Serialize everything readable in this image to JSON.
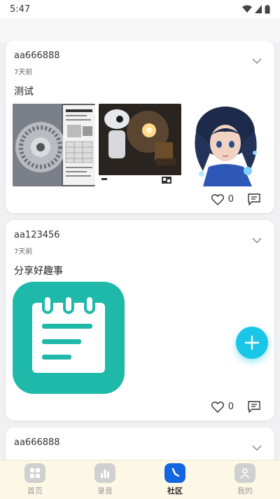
{
  "status_bar": {
    "time": "5:47"
  },
  "posts": [
    {
      "username": "aa666888",
      "time_ago": "7天前",
      "content": "测试",
      "likes": "0",
      "image_subjects": [
        "machine-gear-collage",
        "robot-scene",
        "anime-portrait"
      ]
    },
    {
      "username": "aa123456",
      "time_ago": "7天前",
      "content": "分享好趣事",
      "likes": "0",
      "image_subjects": [
        "notepad-app-icon"
      ]
    },
    {
      "username": "aa666888"
    }
  ],
  "tabbar": {
    "items": [
      {
        "label": "首页",
        "icon": "home-grid-icon"
      },
      {
        "label": "录音",
        "icon": "bar-chart-icon"
      },
      {
        "label": "社区",
        "icon": "compass-icon",
        "active": true
      },
      {
        "label": "我的",
        "icon": "person-icon"
      }
    ]
  },
  "colors": {
    "accent": "#1466e0",
    "fab": "#19c6e8",
    "note_icon": "#1fb9a9",
    "tabbar_bg": "#fdf8e6"
  }
}
